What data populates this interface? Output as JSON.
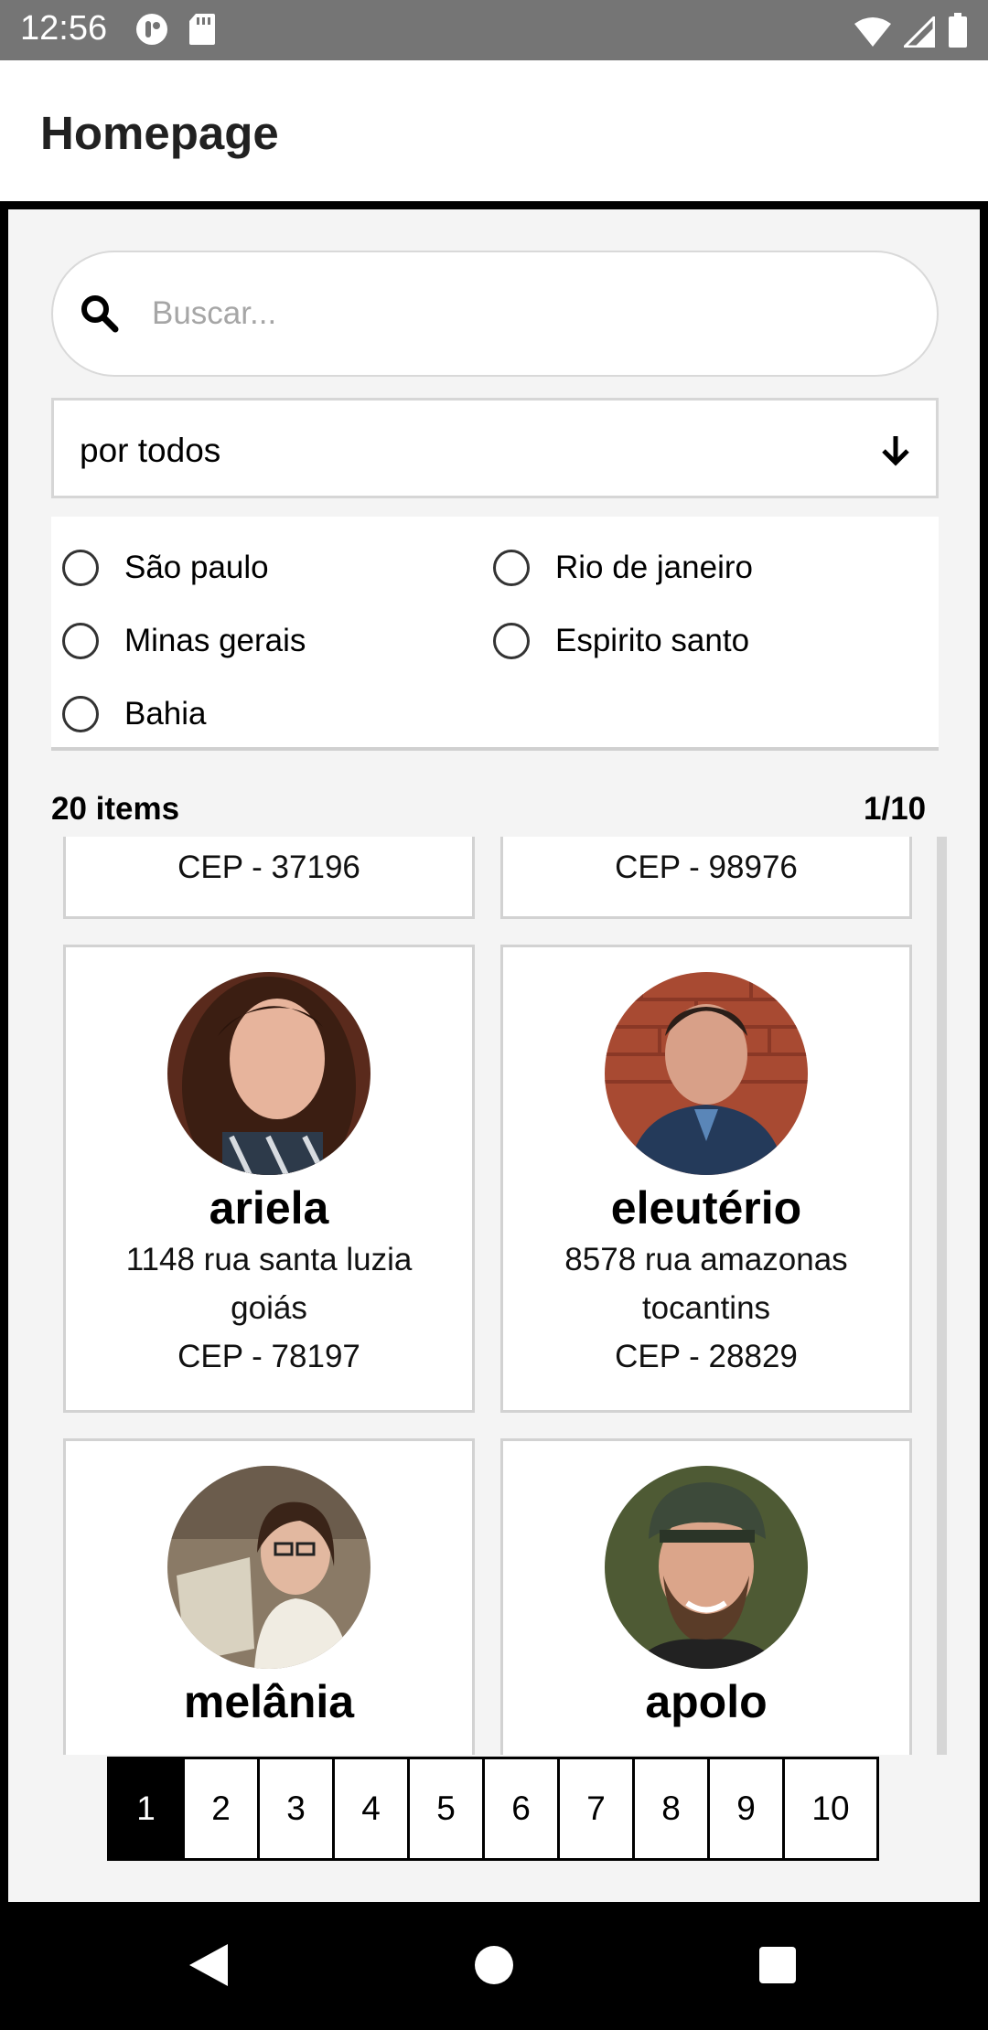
{
  "status_bar": {
    "time": "12:56"
  },
  "app_bar": {
    "title": "Homepage"
  },
  "search": {
    "placeholder": "Buscar...",
    "value": ""
  },
  "filter": {
    "selected": "por todos"
  },
  "states": [
    "São paulo",
    "Rio de janeiro",
    "Minas gerais",
    "Espirito santo",
    "Bahia"
  ],
  "summary": {
    "items": "20 items",
    "page": "1/10"
  },
  "cards": [
    {
      "name": "",
      "street": "",
      "state": "",
      "cep": "CEP - 37196"
    },
    {
      "name": "",
      "street": "",
      "state": "",
      "cep": "CEP - 98976"
    },
    {
      "name": "ariela",
      "street": "1148 rua santa luzia",
      "state": "goiás",
      "cep": "CEP - 78197"
    },
    {
      "name": "eleutério",
      "street": "8578 rua amazonas",
      "state": "tocantins",
      "cep": "CEP - 28829"
    },
    {
      "name": "melânia",
      "street": "",
      "state": "",
      "cep": ""
    },
    {
      "name": "apolo",
      "street": "",
      "state": "",
      "cep": ""
    }
  ],
  "pagination": [
    "1",
    "2",
    "3",
    "4",
    "5",
    "6",
    "7",
    "8",
    "9",
    "10"
  ],
  "colors": {
    "accent": "#000000",
    "background": "#f4f4f4",
    "status_bar": "#757575"
  }
}
